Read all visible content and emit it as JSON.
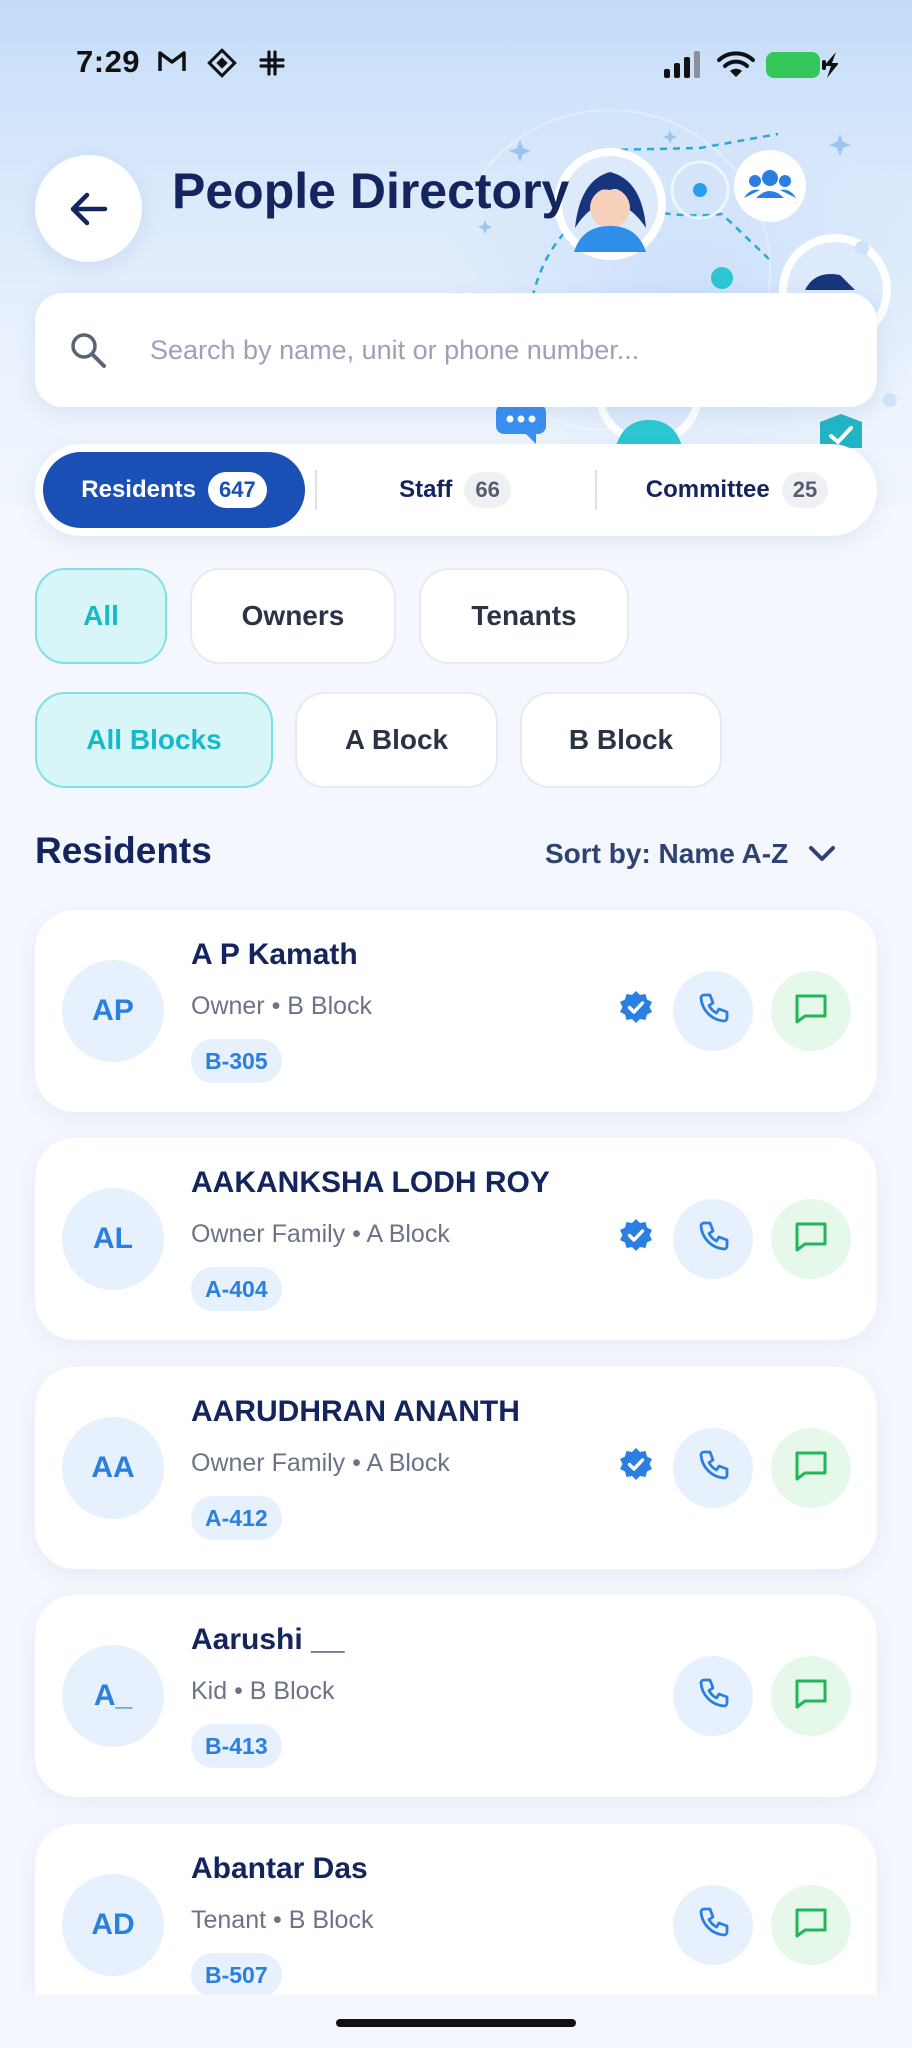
{
  "status_bar": {
    "time": "7:29",
    "icons": [
      "gmail-icon",
      "app-icon",
      "slack-icon",
      "signal-icon",
      "wifi-icon",
      "battery-charging-icon"
    ]
  },
  "header": {
    "title": "People Directory",
    "back_icon": "arrow-left-icon"
  },
  "search": {
    "placeholder": "Search by name, unit or phone number...",
    "value": ""
  },
  "tabs": [
    {
      "label": "Residents",
      "count": "647",
      "active": true
    },
    {
      "label": "Staff",
      "count": "66",
      "active": false
    },
    {
      "label": "Committee",
      "count": "25",
      "active": false
    }
  ],
  "type_filters": [
    {
      "label": "All",
      "active": true
    },
    {
      "label": "Owners",
      "active": false
    },
    {
      "label": "Tenants",
      "active": false
    }
  ],
  "block_filters": [
    {
      "label": "All Blocks",
      "active": true
    },
    {
      "label": "A Block",
      "active": false
    },
    {
      "label": "B Block",
      "active": false
    }
  ],
  "section": {
    "title": "Residents",
    "sort_label": "Sort by: Name A-Z"
  },
  "residents": [
    {
      "initials": "AP",
      "name": "A P Kamath",
      "meta": "Owner • B Block",
      "unit": "B-305",
      "verified": true
    },
    {
      "initials": "AL",
      "name": "AAKANKSHA LODH ROY",
      "meta": "Owner Family • A Block",
      "unit": "A-404",
      "verified": true
    },
    {
      "initials": "AA",
      "name": "AARUDHRAN ANANTH",
      "meta": "Owner Family • A Block",
      "unit": "A-412",
      "verified": true
    },
    {
      "initials": "A_",
      "name": "Aarushi __",
      "meta": "Kid • B Block",
      "unit": "B-413",
      "verified": false
    },
    {
      "initials": "AD",
      "name": "Abantar Das",
      "meta": "Tenant • B Block",
      "unit": "B-507",
      "verified": false
    }
  ],
  "colors": {
    "primary": "#1a4fb5",
    "title": "#13255c",
    "accent_teal": "#17b8c7",
    "call_bg": "#e7f1fd",
    "msg_bg": "#e5f8ea",
    "msg_icon": "#22b55a",
    "verified": "#2a7fe0"
  }
}
